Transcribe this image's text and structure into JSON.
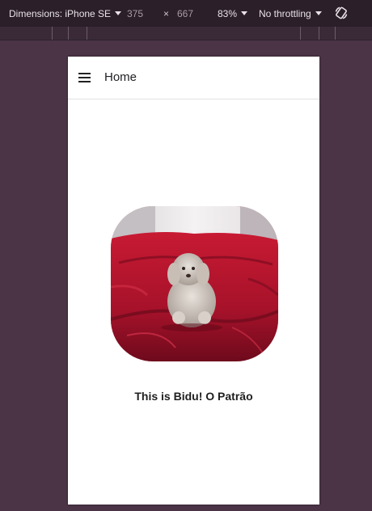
{
  "devtools": {
    "dimensions_label": "Dimensions: iPhone SE",
    "width_value": "375",
    "height_value": "667",
    "times_symbol": "×",
    "zoom": "83%",
    "throttling": "No throttling",
    "rotate_icon": "rotate-icon"
  },
  "app": {
    "menu_icon": "hamburger-menu-icon",
    "title": "Home",
    "caption": "This is Bidu! O Patrão"
  },
  "colors": {
    "frame_background": "#4a3446",
    "toolbar_background": "#2b1f2a",
    "couch_red": "#b0142a"
  }
}
